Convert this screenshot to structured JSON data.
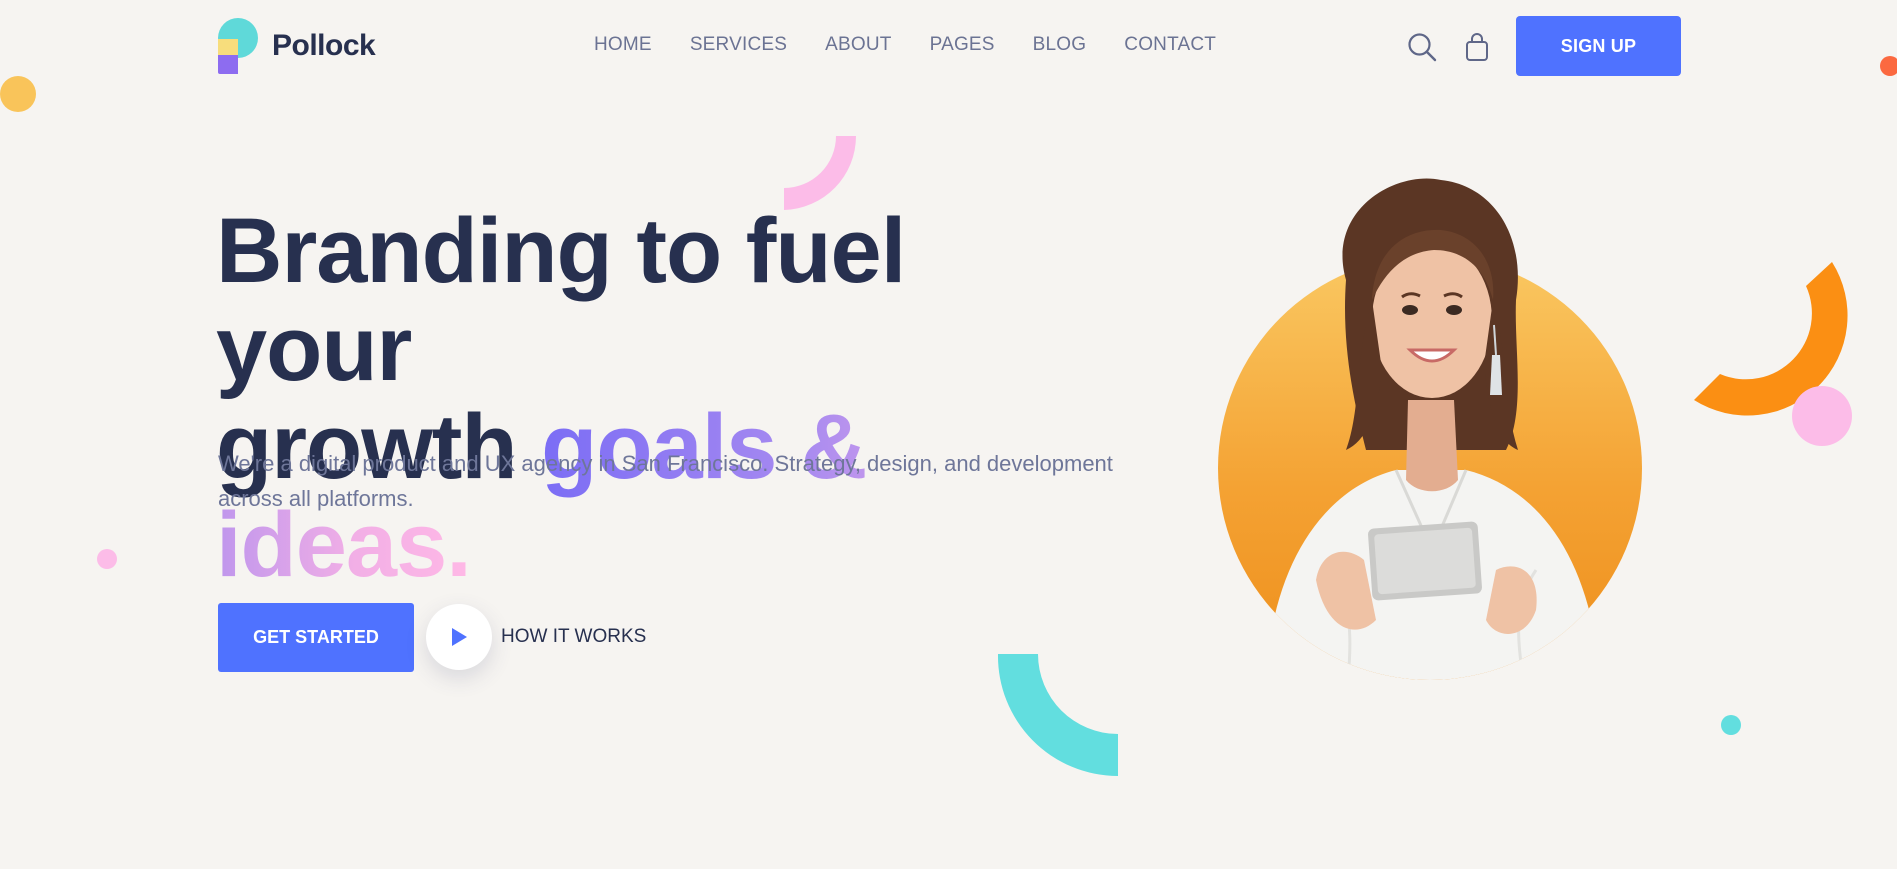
{
  "brand": {
    "name": "Pollock",
    "accent": "#4f72ff",
    "ink": "#27304f"
  },
  "nav": {
    "items": [
      "HOME",
      "SERVICES",
      "ABOUT",
      "PAGES",
      "BLOG",
      "CONTACT"
    ]
  },
  "header": {
    "search_icon": "search-icon",
    "bag_icon": "shopping-bag-icon",
    "signup_label": "SIGN UP"
  },
  "hero": {
    "title_line1": "Branding to fuel your",
    "title_line2_plain": "growth ",
    "title_line2_gradient": "goals & ideas.",
    "description": "We're a digital product and UX agency in San Francisco. Strategy, design, and development across all platforms.",
    "primary_cta": "GET STARTED",
    "secondary_cta": "HOW IT WORKS",
    "play_icon": "play-icon"
  },
  "colors": {
    "background": "#f6f4f1",
    "yellow": "#f9c45a",
    "orange": "#fb8f13",
    "pink": "#fcbce8",
    "teal": "#62dedf",
    "red": "#fb6940"
  }
}
